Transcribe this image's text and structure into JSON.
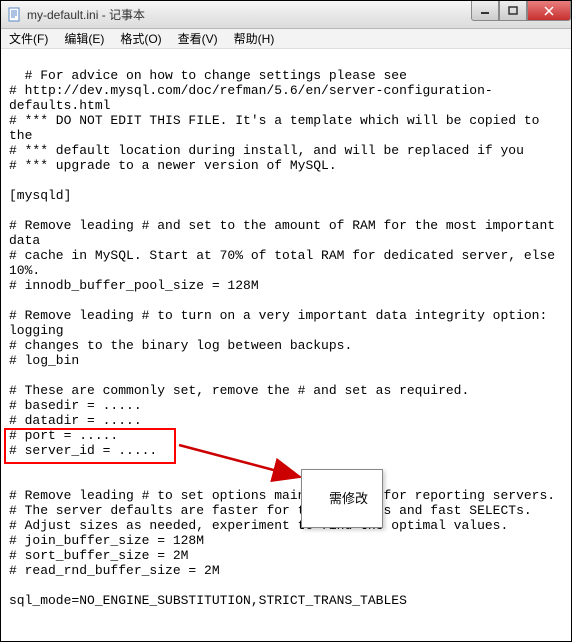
{
  "window": {
    "title": "my-default.ini - 记事本"
  },
  "menu": {
    "file": "文件(F)",
    "edit": "编辑(E)",
    "format": "格式(O)",
    "view": "查看(V)",
    "help": "帮助(H)"
  },
  "content": "# For advice on how to change settings please see\n# http://dev.mysql.com/doc/refman/5.6/en/server-configuration-defaults.html\n# *** DO NOT EDIT THIS FILE. It's a template which will be copied to the\n# *** default location during install, and will be replaced if you\n# *** upgrade to a newer version of MySQL.\n\n[mysqld]\n\n# Remove leading # and set to the amount of RAM for the most important data\n# cache in MySQL. Start at 70% of total RAM for dedicated server, else 10%.\n# innodb_buffer_pool_size = 128M\n\n# Remove leading # to turn on a very important data integrity option: logging\n# changes to the binary log between backups.\n# log_bin\n\n# These are commonly set, remove the # and set as required.\n# basedir = .....\n# datadir = .....\n# port = .....\n# server_id = .....\n\n\n# Remove leading # to set options mainly useful for reporting servers.\n# The server defaults are faster for transactions and fast SELECTs.\n# Adjust sizes as needed, experiment to find the optimal values.\n# join_buffer_size = 128M\n# sort_buffer_size = 2M\n# read_rnd_buffer_size = 2M\n\nsql_mode=NO_ENGINE_SUBSTITUTION,STRICT_TRANS_TABLES",
  "annotation": {
    "label": "需修改"
  }
}
